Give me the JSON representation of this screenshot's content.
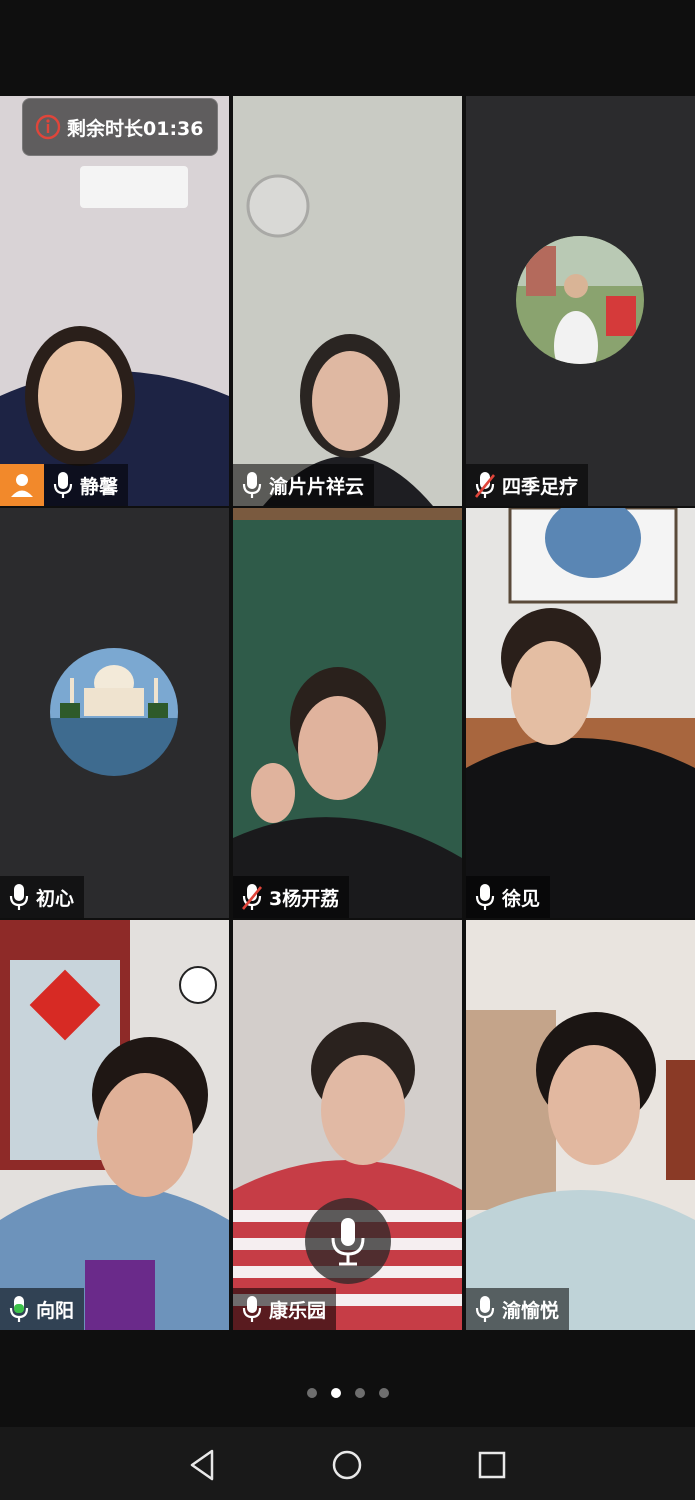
{
  "call": {
    "remaining_label": "剩余时长01:36"
  },
  "participants": [
    {
      "name": "静馨",
      "mic": "on"
    },
    {
      "name": "渝片片祥云",
      "mic": "on"
    },
    {
      "name": "四季足疗",
      "mic": "muted"
    },
    {
      "name": "初心",
      "mic": "on"
    },
    {
      "name": "3杨开荔",
      "mic": "muted"
    },
    {
      "name": "徐见",
      "mic": "on"
    },
    {
      "name": "向阳",
      "mic": "speaking"
    },
    {
      "name": "康乐园",
      "mic": "on"
    },
    {
      "name": "渝愉悦",
      "mic": "on"
    }
  ],
  "pager": {
    "count": 4,
    "active_index": 1
  },
  "colors": {
    "speaking": "#3cc24a",
    "host_badge": "#f2892b",
    "muted_slash": "#e0453a"
  }
}
